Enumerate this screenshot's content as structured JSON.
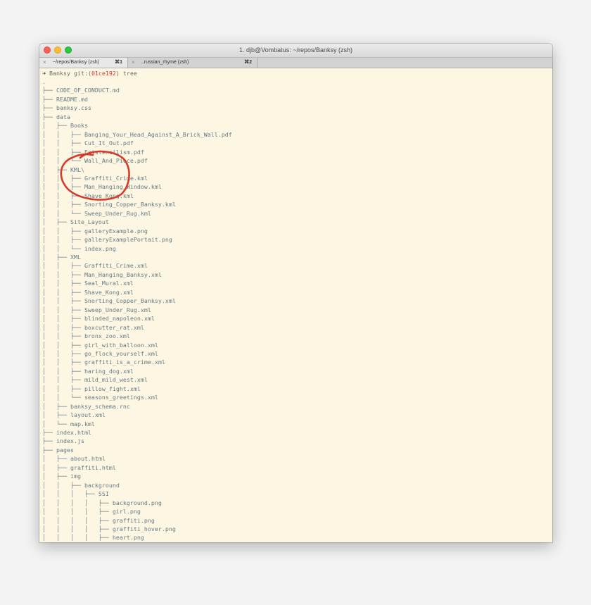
{
  "window": {
    "title": "1. djb@Vombatus: ~/repos/Banksy (zsh)"
  },
  "tabs": [
    {
      "close": "×",
      "label": "~/repos/Banksy (zsh)",
      "shortcut": "⌘1"
    },
    {
      "close": "×",
      "label": "..russian_rhyme (zsh)",
      "shortcut": "⌘2"
    }
  ],
  "prompt": {
    "arrow": "➜",
    "text": " Banksy git:(",
    "hash": "01ce192",
    "close": ") tree"
  },
  "tree": [
    ".",
    "├── CODE_OF_CONDUCT.md",
    "├── README.md",
    "├── banksy.css",
    "├── data",
    "│   ├── Books",
    "│   │   ├── Banging_Your_Head_Against_A_Brick_Wall.pdf",
    "│   │   ├── Cut_It_Out.pdf",
    "│   │   ├── Existencilism.pdf",
    "│   │   └── Wall_And_Piece.pdf",
    "│   ├── KML\\",
    "│   │   ├── Graffiti_Crime.kml",
    "│   │   ├── Man_Hanging_Window.kml",
    "│   │   ├── Shave_Kong.kml",
    "│   │   ├── Snorting_Copper_Banksy.kml",
    "│   │   └── Sweep_Under_Rug.kml",
    "│   ├── Site_Layout",
    "│   │   ├── galleryExample.png",
    "│   │   ├── galleryExamplePortait.png",
    "│   │   └── index.png",
    "│   ├── XML",
    "│   │   ├── Graffiti_Crime.xml",
    "│   │   ├── Man_Hanging_Banksy.xml",
    "│   │   ├── Seal_Mural.xml",
    "│   │   ├── Shave_Kong.xml",
    "│   │   ├── Snorting_Copper_Banksy.xml",
    "│   │   ├── Sweep_Under_Rug.xml",
    "│   │   ├── blinded_napoleon.xml",
    "│   │   ├── boxcutter_rat.xml",
    "│   │   ├── bronx_zoo.xml",
    "│   │   ├── girl_with_balloon.xml",
    "│   │   ├── go_flock_yourself.xml",
    "│   │   ├── graffiti_is_a_crime.xml",
    "│   │   ├── haring_dog.xml",
    "│   │   ├── mild_mild_west.xml",
    "│   │   ├── pillow_fight.xml",
    "│   │   └── seasons_greetings.xml",
    "│   ├── banksy_schema.rnc",
    "│   ├── layout.xml",
    "│   └── map.kml",
    "├── index.html",
    "├── index.js",
    "├── pages",
    "│   ├── about.html",
    "│   ├── graffiti.html",
    "│   ├── img",
    "│   │   ├── background",
    "│   │   │   ├── SSI",
    "│   │   │   │   ├── background.png",
    "│   │   │   │   ├── girl.png",
    "│   │   │   │   ├── graffiti.png",
    "│   │   │   │   ├── graffiti_hover.png",
    "│   │   │   │   ├── heart.png"
  ],
  "colors": {
    "terminal_bg": "#fdf6e3",
    "terminal_text": "#657b83",
    "commit_hash": "#dc322f",
    "annotation_circle": "#d63a2a"
  }
}
